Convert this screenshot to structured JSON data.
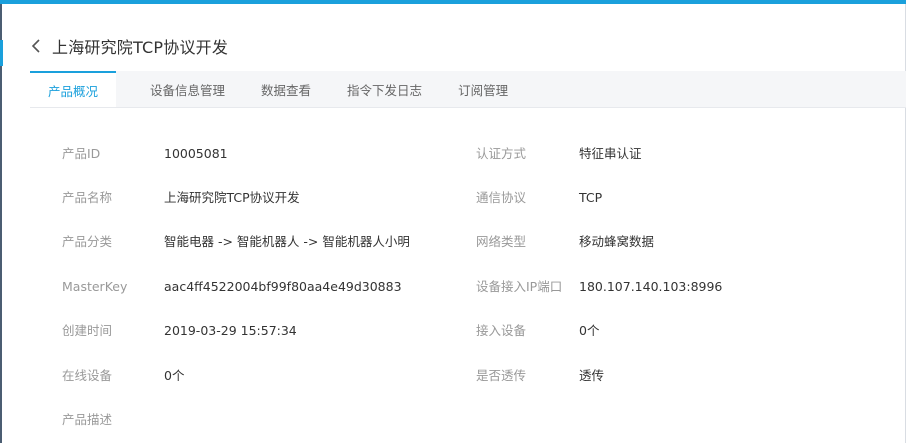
{
  "header": {
    "back_icon": "chevron-left-icon",
    "title": "上海研究院TCP协议开发"
  },
  "tabs": [
    {
      "label": "产品概况",
      "active": true
    },
    {
      "label": "设备信息管理",
      "active": false
    },
    {
      "label": "数据查看",
      "active": false
    },
    {
      "label": "指令下发日志",
      "active": false
    },
    {
      "label": "订阅管理",
      "active": false
    }
  ],
  "info": {
    "left": [
      {
        "label": "产品ID",
        "value": "10005081"
      },
      {
        "label": "产品名称",
        "value": "上海研究院TCP协议开发"
      },
      {
        "label": "产品分类",
        "value": "智能电器 -> 智能机器人 -> 智能机器人小明"
      },
      {
        "label": "MasterKey",
        "value": "aac4ff4522004bf99f80aa4e49d30883"
      },
      {
        "label": "创建时间",
        "value": "2019-03-29 15:57:34"
      },
      {
        "label": "在线设备",
        "value": "0个"
      },
      {
        "label": "产品描述",
        "value": ""
      }
    ],
    "right": [
      {
        "label": "认证方式",
        "value": "特征串认证"
      },
      {
        "label": "通信协议",
        "value": "TCP"
      },
      {
        "label": "网络类型",
        "value": "移动蜂窝数据"
      },
      {
        "label": "设备接入IP端口",
        "value": "180.107.140.103:8996"
      },
      {
        "label": "接入设备",
        "value": "0个"
      },
      {
        "label": "是否透传",
        "value": "透传"
      }
    ]
  },
  "colors": {
    "accent": "#1aa0dc",
    "label": "#999999",
    "value": "#333333",
    "tab_bar": "#f5f6f8"
  }
}
